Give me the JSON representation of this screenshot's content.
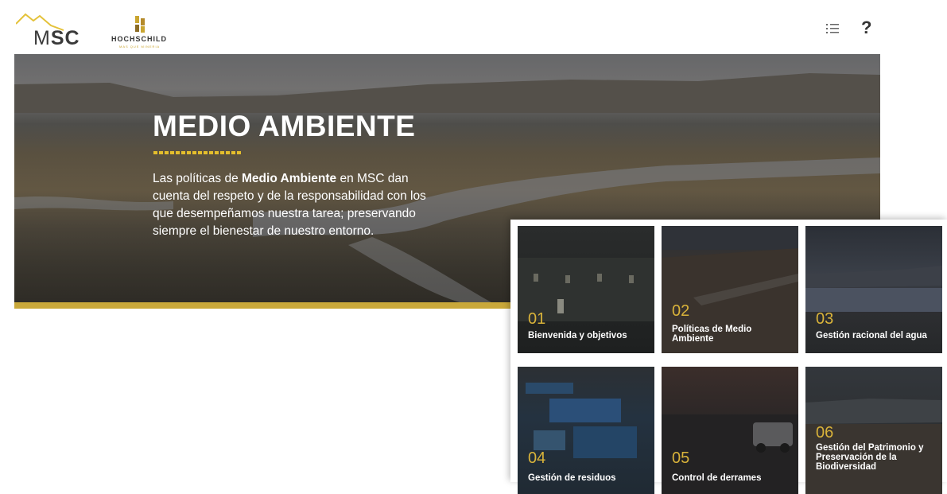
{
  "header": {
    "logo_msc_m": "M",
    "logo_msc_sc": "SC",
    "logo_hochschild": "HOCHSCHILD",
    "logo_hochschild_tagline": "MAS QUE MINERIA",
    "menu_icon": "list-icon",
    "help_label": "?"
  },
  "hero": {
    "title": "MEDIO AMBIENTE",
    "desc_before": "Las políticas de ",
    "desc_bold": "Medio Ambiente",
    "desc_after": " en MSC dan cuenta del respeto y de la responsabilidad con los que desempeñamos nuestra tarea; preservando siempre el bienestar de nuestro entorno."
  },
  "colors": {
    "accent_gold": "#c9a83a",
    "number_gold": "#d9b33a"
  },
  "cards": [
    {
      "num": "01",
      "title": "Bienvenida y objetivos"
    },
    {
      "num": "02",
      "title": "Políticas de Medio Ambiente"
    },
    {
      "num": "03",
      "title": "Gestión racional del agua"
    },
    {
      "num": "04",
      "title": "Gestión de residuos"
    },
    {
      "num": "05",
      "title": "Control de derrames"
    },
    {
      "num": "06",
      "title": "Gestión del Patrimonio y Preservación de la Biodiversidad"
    }
  ]
}
